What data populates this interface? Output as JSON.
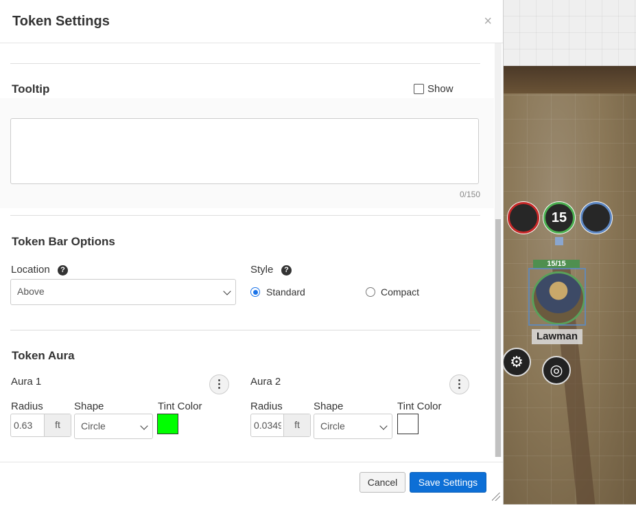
{
  "dialog": {
    "title": "Token Settings",
    "close_glyph": "×"
  },
  "tooltip": {
    "title": "Tooltip",
    "show_label": "Show",
    "show_checked": false,
    "text": "",
    "char_count": "0/150"
  },
  "token_bar": {
    "title": "Token Bar Options",
    "location_label": "Location",
    "location_value": "Above",
    "style_label": "Style",
    "style_options": [
      "Standard",
      "Compact"
    ],
    "style_selected": "Standard",
    "help_glyph": "?"
  },
  "aura": {
    "title": "Token Aura",
    "aura1": {
      "label": "Aura 1",
      "radius_label": "Radius",
      "radius_value": "0.63",
      "unit": "ft",
      "shape_label": "Shape",
      "shape_value": "Circle",
      "tint_label": "Tint Color",
      "tint_color": "#00ff00"
    },
    "aura2": {
      "label": "Aura 2",
      "radius_label": "Radius",
      "radius_value": "0.0349",
      "unit": "ft",
      "shape_label": "Shape",
      "shape_value": "Circle",
      "tint_label": "Tint Color",
      "tint_color": "#ffffff"
    },
    "kebab_glyph": "⋮"
  },
  "footer": {
    "cancel_label": "Cancel",
    "save_label": "Save Settings"
  },
  "map": {
    "status_number": "15",
    "bar_value": "15/15",
    "token_name": "Lawman",
    "settings_glyph": "⚙",
    "target_glyph": "◎"
  }
}
